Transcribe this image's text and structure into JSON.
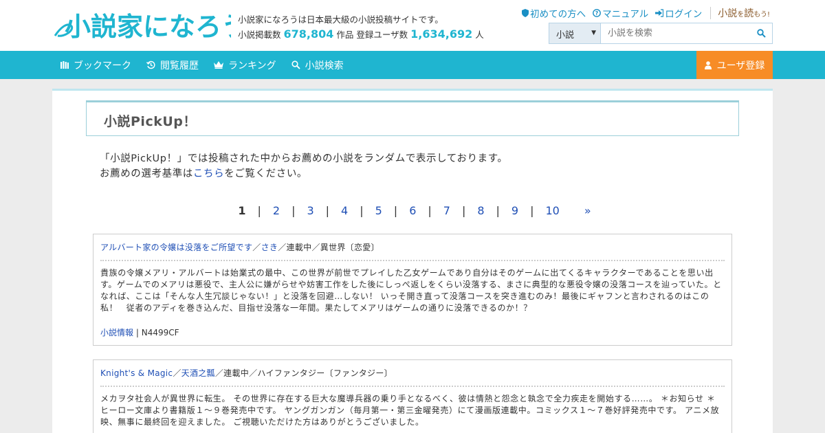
{
  "header": {
    "logo_text": "小説家になろう",
    "site_desc": "小説家になろうは日本最大級の小説投稿サイトです。",
    "stats_works_label": "小説掲載数",
    "stats_works_value": "678,804",
    "stats_works_unit": "作品",
    "stats_users_label": "登録ユーザ数",
    "stats_users_value": "1,634,692",
    "stats_users_unit": "人",
    "links": {
      "beginner": "初めての方へ",
      "manual": "マニュアル",
      "login": "ログイン"
    },
    "yomou_main": "小説",
    "yomou_small": "を",
    "yomou_main2": "読",
    "yomou_small2": "もう!",
    "search": {
      "select_value": "小説",
      "placeholder": "小説を検索"
    }
  },
  "nav": {
    "bookmark": "ブックマーク",
    "history": "閲覧履歴",
    "ranking": "ランキング",
    "search": "小説検索",
    "register": "ユーザ登録"
  },
  "main": {
    "title": "小説PickUp！",
    "intro_line1": "「小説PickUp！」では投稿された中からお薦めの小説をランダムで表示しております。",
    "intro_line2_pre": "お薦めの選考基準は",
    "intro_line2_link": "こちら",
    "intro_line2_post": "をご覧ください。",
    "pager": {
      "current": "1",
      "pages": [
        "2",
        "3",
        "4",
        "5",
        "6",
        "7",
        "8",
        "9",
        "10"
      ],
      "separator": "|",
      "next": "»"
    },
    "novels": [
      {
        "title": "アルバート家の令嬢は没落をご所望です",
        "author": "さき",
        "slash": "／",
        "status": "連載中",
        "genre": "異世界〔恋愛〕",
        "story": "貴族の令嬢メアリ・アルバートは始業式の最中、この世界が前世でプレイした乙女ゲームであり自分はそのゲームに出てくるキャラクターであることを思い出す。ゲームでのメアリは悪役で、主人公に嫌がらせや妨害工作をした後にしっぺ返しをくらい没落する、まさに典型的な悪役令嬢の没落コースを辿っていた。となれば、ここは「そんな人生冗談じゃない！」と没落を回避…しない！ いっそ開き直って没落コースを突き進むのみ！最後にギャフンと言わされるのはこの私！　従者のアディを巻き込んだ、目指せ没落な一年間。果たしてメアリはゲームの通りに没落できるのか！？",
        "info_link": "小説情報",
        "info_sep": "|",
        "ncode": "N4499CF"
      },
      {
        "title": "Knight's & Magic",
        "author": "天酒之瓢",
        "slash": "／",
        "status": "連載中",
        "genre": "ハイファンタジー〔ファンタジー〕",
        "story": "メカヲタ社会人が異世界に転生。 その世界に存在する巨大な魔導兵器の乗り手となるべく、彼は情熱と怨念と執念で全力疾走を開始する……。 ＊お知らせ ＊ ヒーロー文庫より書籍版１～９巻発売中です。 ヤングガンガン（毎月第一・第三金曜発売）にて漫画版連載中。コミックス１～７巻好評発売中です。 アニメ放映、無事に最終回を迎えました。 ご視聴いただけた方はありがとうございました。"
      }
    ]
  }
}
